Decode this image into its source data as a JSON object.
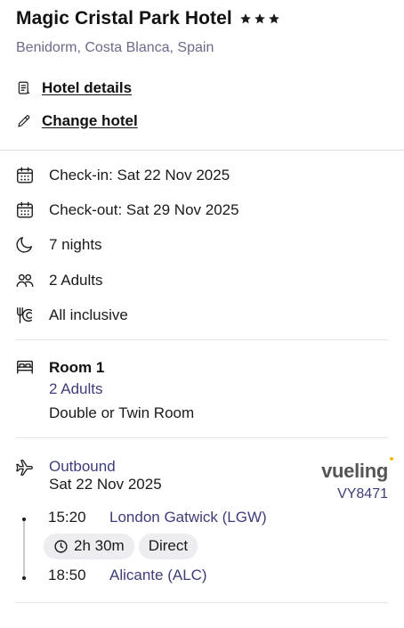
{
  "hotel": {
    "name": "Magic Cristal Park Hotel",
    "stars": 3,
    "location": "Benidorm, Costa Blanca, Spain",
    "details_link": "Hotel details",
    "change_link": "Change hotel"
  },
  "stay": {
    "checkin": "Check-in: Sat 22 Nov 2025",
    "checkout": "Check-out: Sat 29 Nov 2025",
    "nights": "7 nights",
    "guests": "2 Adults",
    "board": "All inclusive"
  },
  "room": {
    "title": "Room 1",
    "guests": "2 Adults",
    "type": "Double or Twin Room"
  },
  "flight": {
    "direction": "Outbound",
    "date": "Sat 22 Nov 2025",
    "airline": "vueling",
    "flight_number": "VY8471",
    "depart_time": "15:20",
    "depart_airport": "London Gatwick (LGW)",
    "duration": "2h 30m",
    "stops": "Direct",
    "arrive_time": "18:50",
    "arrive_airport": "Alicante (ALC)"
  },
  "icons": {
    "star": "star-icon",
    "details": "document-icon",
    "change": "pencil-icon",
    "calendar": "calendar-icon",
    "moon": "moon-icon",
    "people": "people-icon",
    "board": "cutlery-icon",
    "bed": "bed-icon",
    "plane": "plane-icon",
    "clock": "clock-icon"
  },
  "colors": {
    "accent_text": "#3d3d7a",
    "muted_text": "#6b6b8a",
    "chip_bg": "#ececf1",
    "airline_dot": "#f5b800"
  }
}
